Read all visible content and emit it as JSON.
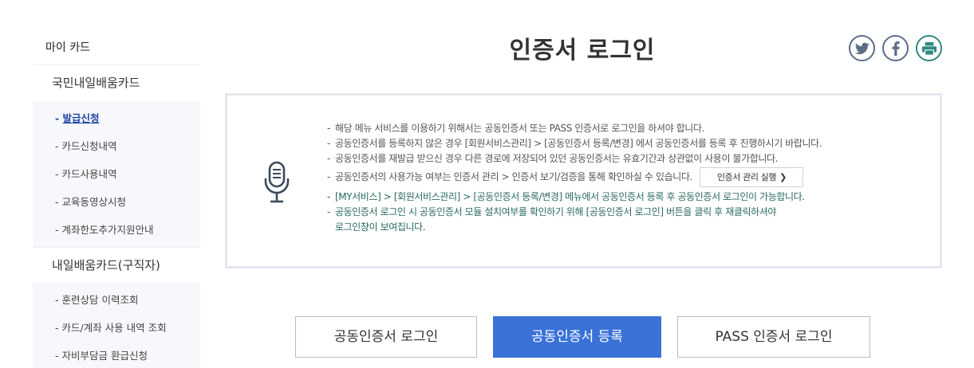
{
  "sidebar": {
    "top": "마이 카드",
    "group1": "국민내일배움카드",
    "group1_items": [
      "발급신청",
      "카드신청내역",
      "카드사용내역",
      "교육동영상시청",
      "계좌한도추가지원안내"
    ],
    "group2": "내일배움카드(구직자)",
    "group2_items": [
      "훈련상담 이력조회",
      "카드/계좌 사용 내역 조회",
      "자비부담금 환급신청"
    ]
  },
  "title": "인증서 로그인",
  "social": {
    "icons": [
      "twitter-icon",
      "facebook-icon",
      "print-icon"
    ]
  },
  "info": {
    "lines": [
      "해당 메뉴 서비스를 이용하기 위해서는 공동인증서 또는 PASS 인증서로 로그인을 하셔야 합니다.",
      "공동인증서를 등록하지 않은 경우 [회원서비스관리] > [공동인증서 등록/변경] 에서 공동인증서를 등록 후 진행하시기 바랍니다.",
      "공동인증서를 재발급 받으신 경우 다른 경로에 저장되어 있던 공동인증서는 유효기간과 상관없이 사용이 불가합니다.",
      "공동인증서의 사용가능 여부는 인증서 관리 > 인증서 보기/검증을 통해 확인하실 수 있습니다.",
      "[MY서비스] > [회원서비스관리] > [공동인증서 등록/변경] 메뉴에서 공동인증서 등록 후 공동인증서 로그인이 가능합니다.",
      "공동인증서 로그인 시 공동인증서 모듈 설치여부를 확인하기 위해 [공동인증서 로그인] 버튼을 클릭 후 재클릭하셔야",
      "로그인창이 보여집니다."
    ],
    "mgmt_button": "인증서 관리 실행",
    "mgmt_chevron": "❯"
  },
  "buttons": {
    "cert_login": "공동인증서 로그인",
    "cert_register": "공동인증서 등록",
    "pass_login": "PASS 인증서 로그인"
  },
  "colors": {
    "primary": "#3a72d8",
    "active_link": "#1d46a3",
    "notice_green": "#2a6a5e"
  }
}
